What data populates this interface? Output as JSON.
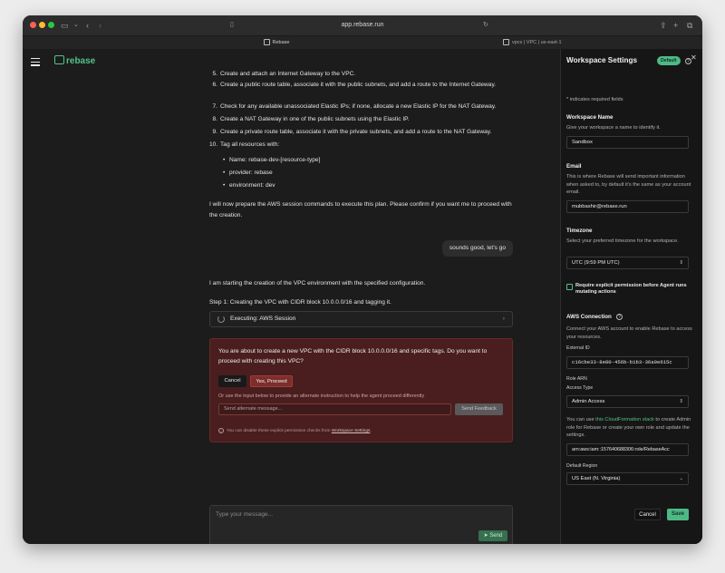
{
  "browser": {
    "url": "app.rebase.run",
    "tabs": [
      {
        "label": "Rebase"
      },
      {
        "label": "vpcs | VPC | us-east-1"
      }
    ]
  },
  "app": {
    "logo_text": "rebase",
    "accent": "#53c08a"
  },
  "chat": {
    "steps": [
      {
        "num": "5.",
        "text": "Create and attach an Internet Gateway to the VPC."
      },
      {
        "num": "6.",
        "text": "Create a public route table, associate it with the public subnets, and add a route to the Internet Gateway."
      },
      {
        "num": "7.",
        "text": "Check for any available unassociated Elastic IPs; if none, allocate a new Elastic IP for the NAT Gateway."
      },
      {
        "num": "8.",
        "text": "Create a NAT Gateway in one of the public subnets using the Elastic IP."
      },
      {
        "num": "9.",
        "text": "Create a private route table, associate it with the private subnets, and add a route to the NAT Gateway."
      },
      {
        "num": "10.",
        "text": "Tag all resources with:"
      }
    ],
    "tags": [
      "Name: rebase-dev-[resource-type]",
      "provider: rebase",
      "environment: dev"
    ],
    "prepare_text": "I will now prepare the AWS session commands to execute this plan. Please confirm if you want me to proceed with the creation.",
    "user_message": "sounds good, let's go",
    "starting_text": "I am starting the creation of the VPC environment with the specified configuration.",
    "step1_text": "Step 1: Creating the VPC with CIDR block 10.0.0.0/16 and tagging it.",
    "executing_label": "Executing: AWS Session",
    "permission": {
      "question": "You are about to create a new VPC with the CIDR block 10.0.0.0/16 and specific tags. Do you want to proceed with creating this VPC?",
      "cancel_label": "Cancel",
      "proceed_label": "Yes, Proceed",
      "alt_instruction": "Or use the input below to provide an alternate instruction to help the agent proceed differently",
      "alt_placeholder": "Send alternate message...",
      "feedback_label": "Send Feedback",
      "note_prefix": "You can disable these explicit permission checks from",
      "note_link": "Workspace Settings",
      "note_suffix": "."
    },
    "composer_placeholder": "Type your message...",
    "send_label": "Send"
  },
  "settings": {
    "title": "Workspace Settings",
    "badge": "Default",
    "required_note": "* indicates required fields",
    "workspace_name": {
      "label": "Workspace Name",
      "desc": "Give your workspace a name to identify it.",
      "value": "Sandbox"
    },
    "email": {
      "label": "Email",
      "desc": "This is where Rebase will send important information when asked to, by default it's the same as your account email.",
      "value": "mubbashir@rebase.run"
    },
    "timezone": {
      "label": "Timezone",
      "desc": "Select your preferred timezone for the workspace.",
      "value": "UTC (9:59 PM UTC)"
    },
    "permission_checkbox": "Require explicit permission before Agent runs mutating actions",
    "aws": {
      "label": "AWS Connection",
      "desc": "Connect your AWS account to enable Rebase to access your resources.",
      "external_id_label": "External ID",
      "external_id": "c16cbe33-8e80-456b-b1b3-36a0e615c",
      "role_arn_label": "Role ARN",
      "access_type_label": "Access Type",
      "access_type": "Admin Access",
      "help_prefix": "You can use",
      "help_link": "this CloudFormation stack",
      "help_suffix": "to create Admin role for Rebase or create your own role and update the settings.",
      "role_arn": "arn:aws:iam::157640688306:role/RebaseAcc",
      "default_region_label": "Default Region",
      "default_region": "US East (N. Virginia)"
    },
    "cancel_label": "Cancel",
    "save_label": "Save"
  }
}
